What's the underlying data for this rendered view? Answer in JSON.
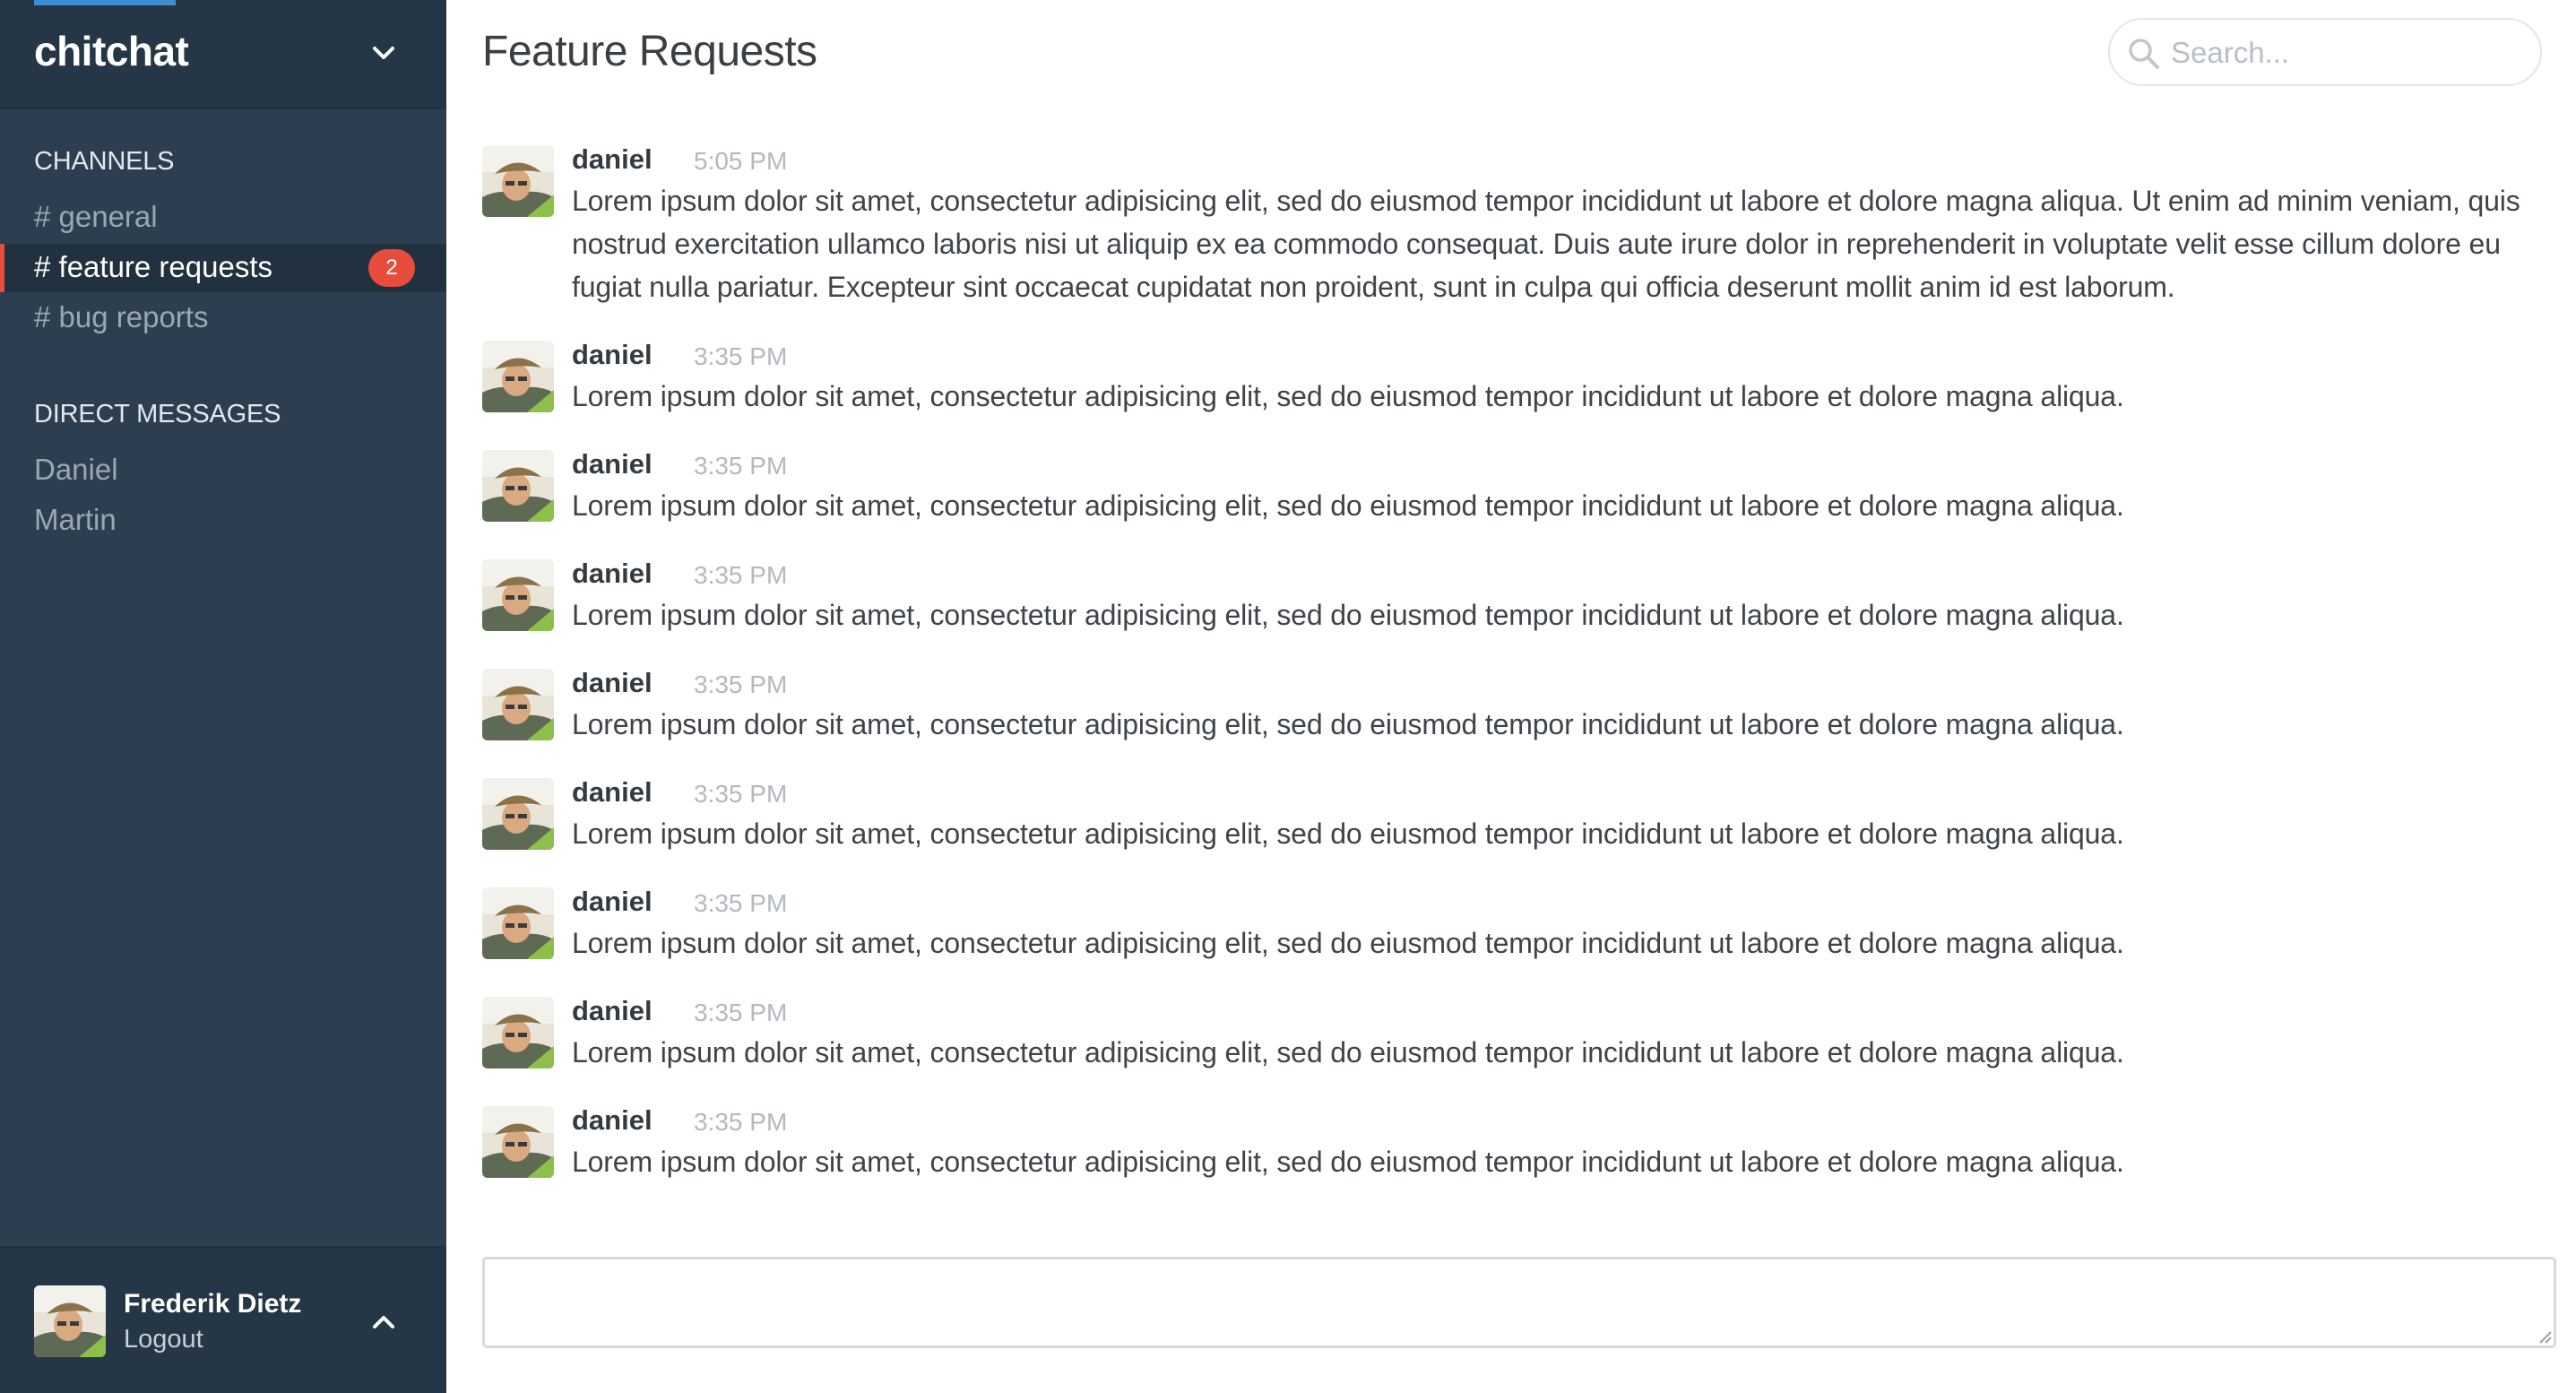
{
  "app": {
    "name": "chitchat"
  },
  "sidebar": {
    "channels_label": "CHANNELS",
    "channels": [
      {
        "label": "# general"
      },
      {
        "label": "# feature requests",
        "badge": "2",
        "active": true
      },
      {
        "label": "# bug reports"
      }
    ],
    "direct_messages_label": "DIRECT MESSAGES",
    "direct_messages": [
      {
        "label": "Daniel"
      },
      {
        "label": "Martin"
      }
    ]
  },
  "user": {
    "name": "Frederik Dietz",
    "logout_label": "Logout"
  },
  "main": {
    "title": "Feature Requests",
    "search": {
      "placeholder": "Search..."
    },
    "composer": {
      "value": ""
    }
  },
  "messages": [
    {
      "author": "daniel",
      "time": "5:05 PM",
      "text": "Lorem ipsum dolor sit amet, consectetur adipisicing elit, sed do eiusmod tempor incididunt ut labore et dolore magna aliqua. Ut enim ad minim veniam, quis nostrud exercitation ullamco laboris nisi ut aliquip ex ea commodo consequat. Duis aute irure dolor in reprehenderit in voluptate velit esse cillum dolore eu fugiat nulla pariatur. Excepteur sint occaecat cupidatat non proident, sunt in culpa qui officia deserunt mollit anim id est laborum."
    },
    {
      "author": "daniel",
      "time": "3:35 PM",
      "text": "Lorem ipsum dolor sit amet, consectetur adipisicing elit, sed do eiusmod tempor incididunt ut labore et dolore magna aliqua."
    },
    {
      "author": "daniel",
      "time": "3:35 PM",
      "text": "Lorem ipsum dolor sit amet, consectetur adipisicing elit, sed do eiusmod tempor incididunt ut labore et dolore magna aliqua."
    },
    {
      "author": "daniel",
      "time": "3:35 PM",
      "text": "Lorem ipsum dolor sit amet, consectetur adipisicing elit, sed do eiusmod tempor incididunt ut labore et dolore magna aliqua."
    },
    {
      "author": "daniel",
      "time": "3:35 PM",
      "text": "Lorem ipsum dolor sit amet, consectetur adipisicing elit, sed do eiusmod tempor incididunt ut labore et dolore magna aliqua."
    },
    {
      "author": "daniel",
      "time": "3:35 PM",
      "text": "Lorem ipsum dolor sit amet, consectetur adipisicing elit, sed do eiusmod tempor incididunt ut labore et dolore magna aliqua."
    },
    {
      "author": "daniel",
      "time": "3:35 PM",
      "text": "Lorem ipsum dolor sit amet, consectetur adipisicing elit, sed do eiusmod tempor incididunt ut labore et dolore magna aliqua."
    },
    {
      "author": "daniel",
      "time": "3:35 PM",
      "text": "Lorem ipsum dolor sit amet, consectetur adipisicing elit, sed do eiusmod tempor incididunt ut labore et dolore magna aliqua."
    },
    {
      "author": "daniel",
      "time": "3:35 PM",
      "text": "Lorem ipsum dolor sit amet, consectetur adipisicing elit, sed do eiusmod tempor incididunt ut labore et dolore magna aliqua."
    }
  ],
  "colors": {
    "sidebar_bg": "#2c3e50",
    "accent": "#3e8ed0",
    "badge": "#e74c3c"
  }
}
